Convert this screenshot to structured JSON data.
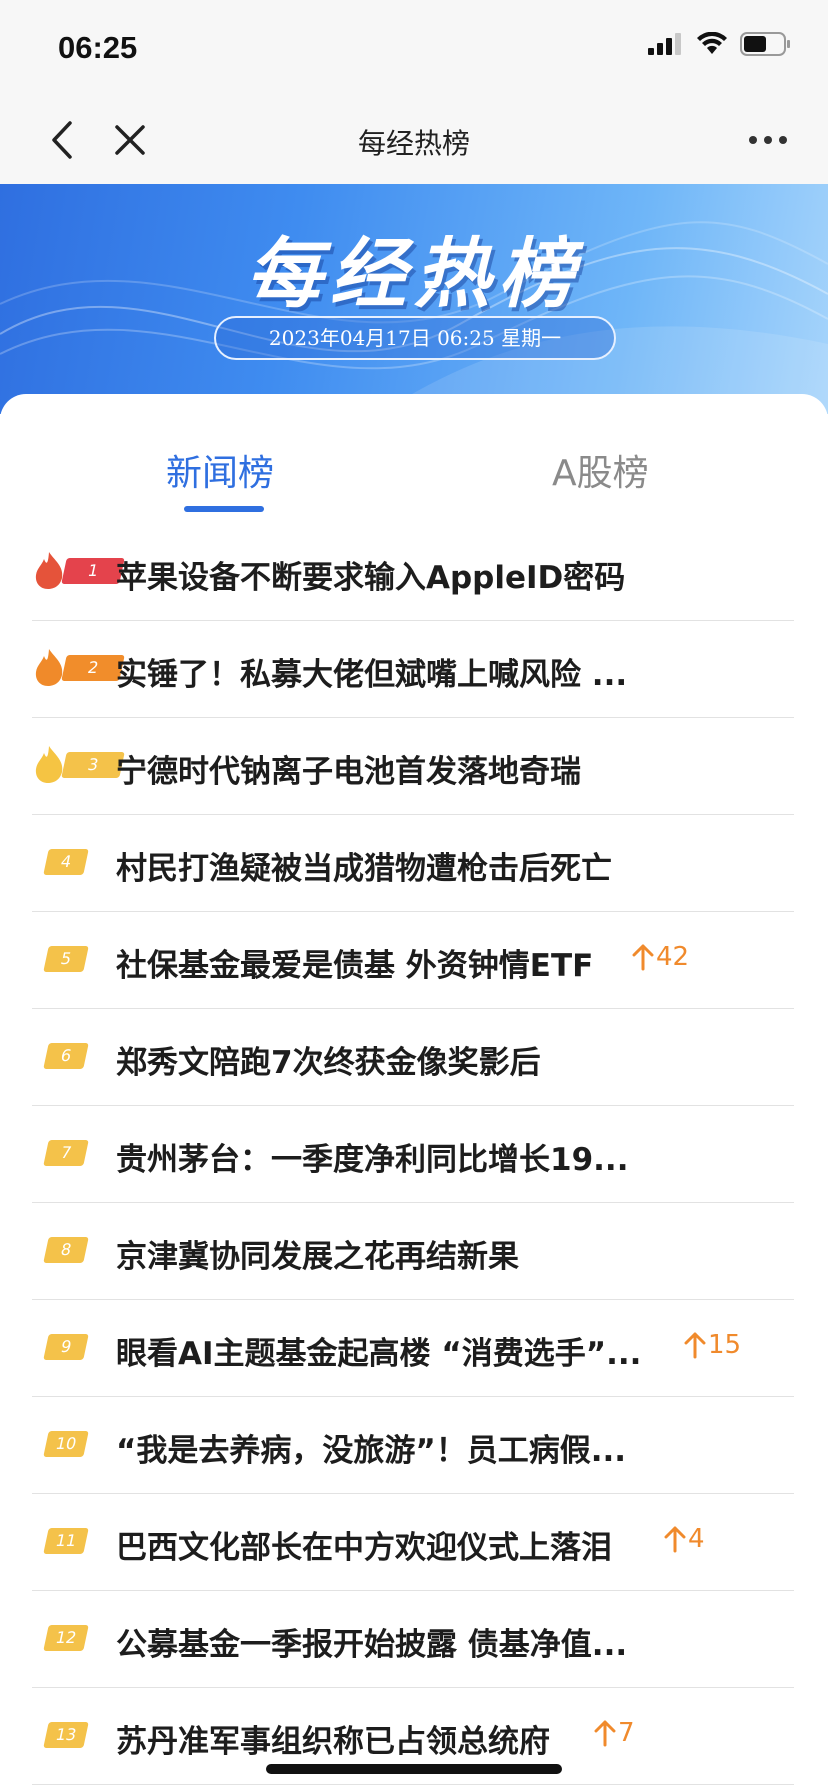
{
  "status_bar": {
    "time": "06:25"
  },
  "nav": {
    "title": "每经热榜"
  },
  "banner": {
    "title": "每经热榜",
    "datetime": "2023年04月17日 06:25 星期一"
  },
  "tabs": [
    {
      "label": "新闻榜",
      "active": true
    },
    {
      "label": "A股榜",
      "active": false
    }
  ],
  "colors": {
    "accent": "#2f6fe0",
    "rank1": "#e4434c",
    "rank2": "#f18d2b",
    "rank3_plus": "#f4c24a",
    "trend_up": "#f08a2c"
  },
  "items": [
    {
      "rank": "1",
      "title": "苹果设备不断要求输入AppleID密码",
      "trend": ""
    },
    {
      "rank": "2",
      "title": "实锤了！私募大佬但斌嘴上喊风险 ...",
      "trend": ""
    },
    {
      "rank": "3",
      "title": "宁德时代钠离子电池首发落地奇瑞",
      "trend": ""
    },
    {
      "rank": "4",
      "title": "村民打渔疑被当成猎物遭枪击后死亡",
      "trend": ""
    },
    {
      "rank": "5",
      "title": "社保基金最爱是债基 外资钟情ETF",
      "trend": "42"
    },
    {
      "rank": "6",
      "title": "郑秀文陪跑7次终获金像奖影后",
      "trend": ""
    },
    {
      "rank": "7",
      "title": "贵州茅台：一季度净利同比增长19...",
      "trend": ""
    },
    {
      "rank": "8",
      "title": "京津冀协同发展之花再结新果",
      "trend": ""
    },
    {
      "rank": "9",
      "title": "眼看AI主题基金起高楼 “消费选手”...",
      "trend": "15"
    },
    {
      "rank": "10",
      "title": "“我是去养病，没旅游”！员工病假...",
      "trend": ""
    },
    {
      "rank": "11",
      "title": "巴西文化部长在中方欢迎仪式上落泪",
      "trend": "4"
    },
    {
      "rank": "12",
      "title": "公募基金一季报开始披露 债基净值...",
      "trend": ""
    },
    {
      "rank": "13",
      "title": "苏丹准军事组织称已占领总统府",
      "trend": "7"
    }
  ]
}
